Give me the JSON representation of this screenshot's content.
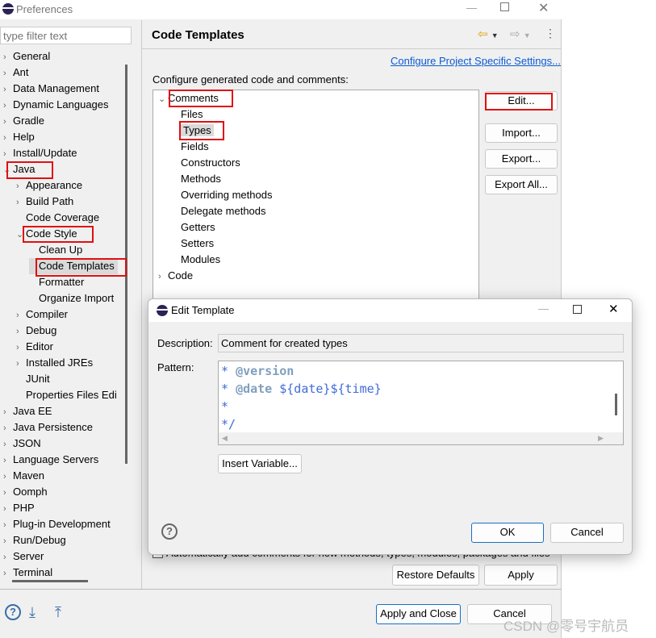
{
  "window": {
    "title": "Preferences"
  },
  "filter": {
    "placeholder": "type filter text"
  },
  "tree": [
    {
      "label": "General",
      "level": 0,
      "exp": "closed"
    },
    {
      "label": "Ant",
      "level": 0,
      "exp": "closed"
    },
    {
      "label": "Data Management",
      "level": 0,
      "exp": "closed"
    },
    {
      "label": "Dynamic Languages",
      "level": 0,
      "exp": "closed"
    },
    {
      "label": "Gradle",
      "level": 0,
      "exp": "closed"
    },
    {
      "label": "Help",
      "level": 0,
      "exp": "closed"
    },
    {
      "label": "Install/Update",
      "level": 0,
      "exp": "closed"
    },
    {
      "label": "Java",
      "level": 0,
      "exp": "open"
    },
    {
      "label": "Appearance",
      "level": 1,
      "exp": "closed"
    },
    {
      "label": "Build Path",
      "level": 1,
      "exp": "closed"
    },
    {
      "label": "Code Coverage",
      "level": 1,
      "exp": "none"
    },
    {
      "label": "Code Style",
      "level": 1,
      "exp": "open"
    },
    {
      "label": "Clean Up",
      "level": 2,
      "exp": "none"
    },
    {
      "label": "Code Templates",
      "level": 2,
      "exp": "none",
      "selected": true
    },
    {
      "label": "Formatter",
      "level": 2,
      "exp": "none"
    },
    {
      "label": "Organize Import",
      "level": 2,
      "exp": "none"
    },
    {
      "label": "Compiler",
      "level": 1,
      "exp": "closed"
    },
    {
      "label": "Debug",
      "level": 1,
      "exp": "closed"
    },
    {
      "label": "Editor",
      "level": 1,
      "exp": "closed"
    },
    {
      "label": "Installed JREs",
      "level": 1,
      "exp": "closed"
    },
    {
      "label": "JUnit",
      "level": 1,
      "exp": "none"
    },
    {
      "label": "Properties Files Edi",
      "level": 1,
      "exp": "none"
    },
    {
      "label": "Java EE",
      "level": 0,
      "exp": "closed"
    },
    {
      "label": "Java Persistence",
      "level": 0,
      "exp": "closed"
    },
    {
      "label": "JSON",
      "level": 0,
      "exp": "closed"
    },
    {
      "label": "Language Servers",
      "level": 0,
      "exp": "closed"
    },
    {
      "label": "Maven",
      "level": 0,
      "exp": "closed"
    },
    {
      "label": "Oomph",
      "level": 0,
      "exp": "closed"
    },
    {
      "label": "PHP",
      "level": 0,
      "exp": "closed"
    },
    {
      "label": "Plug-in Development",
      "level": 0,
      "exp": "closed"
    },
    {
      "label": "Run/Debug",
      "level": 0,
      "exp": "closed"
    },
    {
      "label": "Server",
      "level": 0,
      "exp": "closed"
    },
    {
      "label": "Terminal",
      "level": 0,
      "exp": "closed"
    }
  ],
  "page": {
    "title": "Code Templates",
    "link": "Configure Project Specific Settings...",
    "intro": "Configure generated code and comments:",
    "templates": [
      {
        "label": "Comments",
        "level": 0,
        "exp": "open"
      },
      {
        "label": "Files",
        "level": 1
      },
      {
        "label": "Types",
        "level": 1,
        "selected": true
      },
      {
        "label": "Fields",
        "level": 1
      },
      {
        "label": "Constructors",
        "level": 1
      },
      {
        "label": "Methods",
        "level": 1
      },
      {
        "label": "Overriding methods",
        "level": 1
      },
      {
        "label": "Delegate methods",
        "level": 1
      },
      {
        "label": "Getters",
        "level": 1
      },
      {
        "label": "Setters",
        "level": 1
      },
      {
        "label": "Modules",
        "level": 1
      },
      {
        "label": "Code",
        "level": 0,
        "exp": "closed"
      }
    ],
    "buttons": {
      "edit": "Edit...",
      "import": "Import...",
      "export": "Export...",
      "export_all": "Export All..."
    },
    "auto_comment": "Automatically add comments for new methods, types, modules, packages and files",
    "restore": "Restore Defaults",
    "apply": "Apply"
  },
  "footer": {
    "apply_close": "Apply and Close",
    "cancel": "Cancel"
  },
  "dialog": {
    "title": "Edit Template",
    "description_label": "Description:",
    "description": "Comment for created types",
    "pattern_label": "Pattern:",
    "pattern": [
      {
        "star": "* ",
        "tag": "@version",
        "rest": ""
      },
      {
        "star": "* ",
        "tag": "@date",
        "rest": " ${date}${time}"
      },
      {
        "star": "*",
        "tag": "",
        "rest": ""
      },
      {
        "star": "*/",
        "tag": "",
        "rest": ""
      }
    ],
    "insert_variable": "Insert Variable...",
    "ok": "OK",
    "cancel": "Cancel"
  },
  "watermark": "CSDN @零号宇航员",
  "colors": {
    "highlight": "#e01010",
    "accent": "#1a6fc4",
    "link": "#0b5bd3"
  }
}
